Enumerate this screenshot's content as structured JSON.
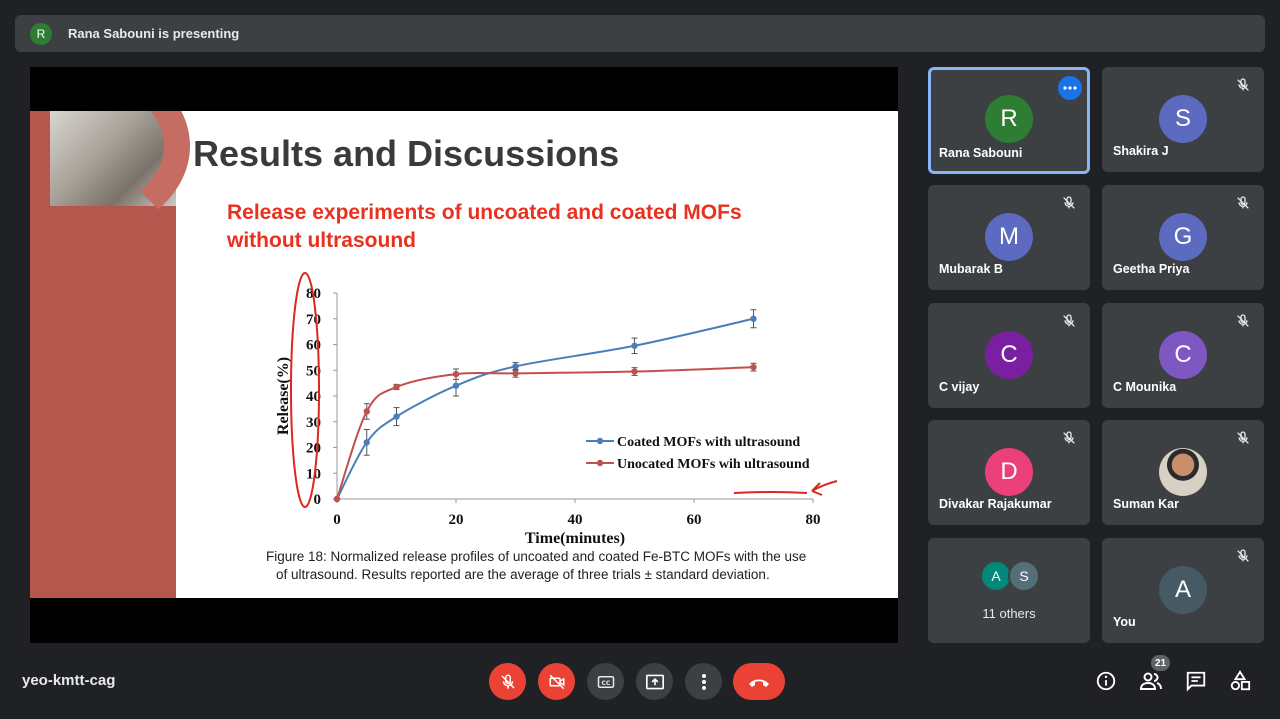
{
  "presenter_banner": {
    "initial": "R",
    "text": "Rana Sabouni is presenting"
  },
  "slide": {
    "title": "Results and Discussions",
    "subtitle_line1": "Release experiments of uncoated and coated MOFs",
    "subtitle_line2": "without ultrasound",
    "caption_line1": "Figure 18: Normalized release profiles of uncoated and coated Fe-BTC MOFs with the use",
    "caption_line2": "of ultrasound. Results reported are the average of three trials ± standard deviation."
  },
  "chart_data": {
    "type": "line",
    "xlabel": "Time(minutes)",
    "ylabel": "Release(%)",
    "xlim": [
      0,
      80
    ],
    "ylim": [
      0,
      80
    ],
    "xticks": [
      "0",
      "20",
      "40",
      "60",
      "80"
    ],
    "yticks": [
      "0",
      "10",
      "20",
      "30",
      "40",
      "50",
      "60",
      "70",
      "80"
    ],
    "legend_position": "bottom-right",
    "series": [
      {
        "name": "Coated MOFs with ultrasound",
        "color": "#4a7ebb",
        "x": [
          0,
          5,
          10,
          20,
          30,
          50,
          70
        ],
        "y": [
          0,
          22,
          32,
          44,
          51.5,
          59.5,
          70
        ],
        "err": [
          0,
          5,
          3.5,
          4,
          1.5,
          3,
          3.5
        ]
      },
      {
        "name": "Unocated MOFs wih ultrasound",
        "color": "#c0504d",
        "x": [
          0,
          5,
          10,
          20,
          30,
          50,
          70
        ],
        "y": [
          0,
          34,
          43.5,
          48.5,
          48.8,
          49.5,
          51.2
        ],
        "err": [
          0,
          3,
          1,
          2,
          1.5,
          1.5,
          1.5
        ]
      }
    ]
  },
  "participants": [
    {
      "name": "Rana Sabouni",
      "initial": "R",
      "color": "#2e7d32",
      "muted": false,
      "active": true
    },
    {
      "name": "Shakira J",
      "initial": "S",
      "color": "#5c6bc0",
      "muted": true
    },
    {
      "name": "Mubarak B",
      "initial": "M",
      "color": "#5c6bc0",
      "muted": true
    },
    {
      "name": "Geetha Priya",
      "initial": "G",
      "color": "#5c6bc0",
      "muted": true
    },
    {
      "name": "C vijay",
      "initial": "C",
      "color": "#7b1fa2",
      "muted": true
    },
    {
      "name": "C Mounika",
      "initial": "C",
      "color": "#7e57c2",
      "muted": true
    },
    {
      "name": "Divakar Rajakumar",
      "initial": "D",
      "color": "#ec407a",
      "muted": true
    },
    {
      "name": "Suman Kar",
      "initial": "",
      "color": "#8d6e63",
      "muted": true,
      "photo": true
    },
    {
      "name": "You",
      "initial": "A",
      "color": "#455a64",
      "muted": true
    }
  ],
  "others": {
    "label": "11 others",
    "initials": [
      "A",
      "S"
    ],
    "colors": [
      "#00897b",
      "#546e7a"
    ]
  },
  "footer": {
    "meeting_code": "yeo-kmtt-cag",
    "participant_count": "21",
    "icons": [
      "mic-off-icon",
      "camera-off-icon",
      "captions-icon",
      "present-icon",
      "more-options-icon",
      "end-call-icon",
      "info-icon",
      "people-icon",
      "chat-icon",
      "activities-icon"
    ]
  }
}
